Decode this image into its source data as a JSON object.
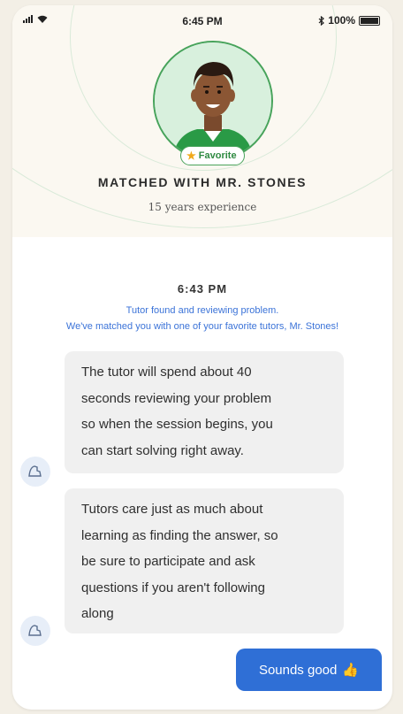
{
  "status_bar": {
    "time": "6:45 PM",
    "battery": "100%"
  },
  "tutor": {
    "badge": "Favorite",
    "matched_title": "MATCHED WITH MR. STONES",
    "experience": "15 years experience"
  },
  "chat": {
    "timestamp": "6:43 PM",
    "system_line_1": "Tutor found and reviewing problem.",
    "system_line_2": "We've matched you with one of your favorite tutors, Mr. Stones!",
    "messages": [
      {
        "lines": [
          "The tutor will spend about 40",
          "seconds reviewing your problem",
          "so when the session begins, you",
          "can start solving right away."
        ]
      },
      {
        "lines": [
          "Tutors care just as much about",
          "learning as finding the answer, so",
          "be sure to participate and ask",
          "questions if you aren't following",
          "along"
        ]
      }
    ],
    "reply": {
      "label": "Sounds good",
      "emoji": "👍"
    }
  },
  "colors": {
    "accent_blue": "#2f6fd6",
    "accent_green": "#47a35b",
    "bubble_gray": "#f0f0f0"
  }
}
